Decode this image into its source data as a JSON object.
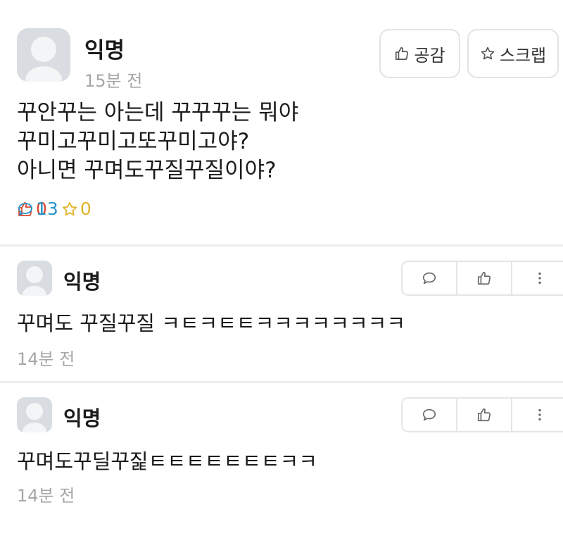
{
  "post": {
    "author": "익명",
    "time": "15분 전",
    "like_button_label": "공감",
    "scrap_button_label": "스크랩",
    "body": "꾸안꾸는 아는데 꾸꾸꾸는 뭐야\n꾸미고꾸미고또꾸미고야?\n아니면 꾸며도꾸질꾸질이야?",
    "stats": {
      "likes": "0",
      "comments": "13",
      "scraps": "0"
    }
  },
  "comments": [
    {
      "author": "익명",
      "text": "꾸며도 꾸질꾸질 ㅋㅌㅋㅌㅌㅋㅋㅋㅋㅋㅋㅋㅋ",
      "time": "14분 전"
    },
    {
      "author": "익명",
      "text": "꾸며도꾸딜꾸짍ㅌㅌㅌㅌㅌㅌㅌㅋㅋ",
      "time": "14분 전"
    }
  ],
  "icons": {
    "thumbs_up": "thumbs-up-icon",
    "star": "star-icon",
    "speech_bubble": "speech-bubble-icon",
    "more": "more-vertical-icon"
  },
  "colors": {
    "like": "#d9482f",
    "comment": "#2796cc",
    "scrap": "#e2b42a",
    "muted": "#a6a6a6",
    "avatar_bg": "#d9dde1"
  }
}
